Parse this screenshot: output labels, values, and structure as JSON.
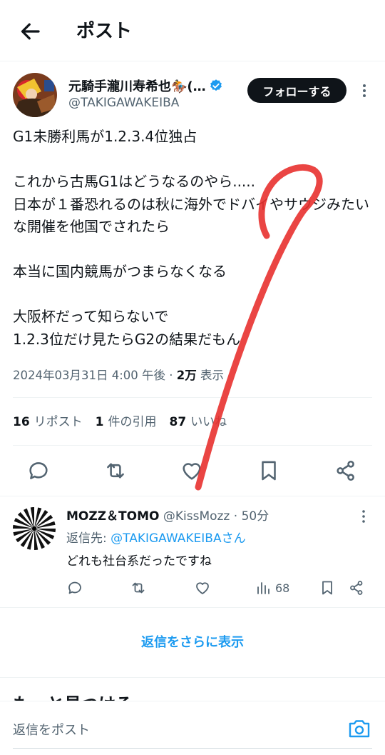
{
  "header": {
    "title": "ポスト"
  },
  "tweet": {
    "author_name": "元騎手瀧川寿希也🏇(…",
    "handle": "@TAKIGAWAKEIBA",
    "follow_label": "フォローする",
    "text": "G1未勝利馬が1.2.3.4位独占\n\nこれから古馬G1はどうなるのやら.....\n日本が１番恐れるのは秋に海外でドバイやサウジみたいな開催を他国でされたら\n\n本当に国内競馬がつまらなくなる\n\n大阪杯だって知らないで\n1.2.3位だけ見たらG2の結果だもん",
    "timestamp": "2024年03月31日 4:00 午後 · ",
    "views_count": "2万",
    "views_label": " 表示",
    "stats": {
      "reposts_count": "16",
      "reposts_label": "リポスト",
      "quotes_count": "1",
      "quotes_label": "件の引用",
      "likes_count": "87",
      "likes_label": "いいね"
    }
  },
  "reply": {
    "name": "MOZZ＆TOMO",
    "handle": "@KissMozz",
    "time": " · 50分",
    "reply_to_label": "返信先: ",
    "reply_to_handle": "@TAKIGAWAKEIBAさん",
    "text": "どれも社台系だったですね",
    "views": "68"
  },
  "show_more_label": "返信をさらに表示",
  "partial_heading": "もっと見つける",
  "composer": {
    "placeholder": "返信をポスト"
  },
  "colors": {
    "accent": "#1d9bf0",
    "text": "#0f1419",
    "muted": "#536471",
    "annotation": "#e8312f"
  }
}
